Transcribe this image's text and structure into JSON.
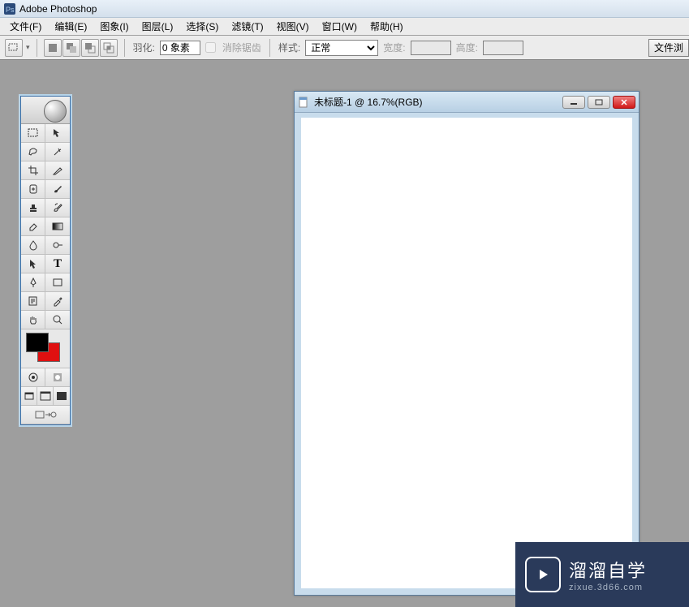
{
  "titlebar": {
    "app_name": "Adobe Photoshop"
  },
  "menubar": {
    "items": [
      {
        "label": "文件(F)"
      },
      {
        "label": "编辑(E)"
      },
      {
        "label": "图象(I)"
      },
      {
        "label": "图层(L)"
      },
      {
        "label": "选择(S)"
      },
      {
        "label": "滤镜(T)"
      },
      {
        "label": "视图(V)"
      },
      {
        "label": "窗口(W)"
      },
      {
        "label": "帮助(H)"
      }
    ]
  },
  "optionsbar": {
    "feather_label": "羽化:",
    "feather_value": "0 象素",
    "antialias_label": "消除锯齿",
    "style_label": "样式:",
    "style_value": "正常",
    "width_label": "宽度:",
    "width_value": "",
    "height_label": "高度:",
    "height_value": "",
    "file_browse_label": "文件浏"
  },
  "toolbox": {
    "tools": [
      [
        "rect-marquee",
        "move"
      ],
      [
        "lasso",
        "magic-wand"
      ],
      [
        "crop",
        "slice"
      ],
      [
        "healing",
        "brush"
      ],
      [
        "stamp",
        "history-brush"
      ],
      [
        "eraser",
        "gradient"
      ],
      [
        "blur",
        "dodge"
      ],
      [
        "path-select",
        "type"
      ],
      [
        "pen",
        "rectangle"
      ],
      [
        "notes",
        "eyedropper"
      ],
      [
        "hand",
        "zoom"
      ]
    ],
    "fg_color": "#000000",
    "bg_color": "#e01010",
    "mode_row": [
      "standard-mode",
      "quickmask-mode"
    ],
    "screen_row": [
      "screen-std",
      "screen-full-menu",
      "screen-full"
    ],
    "jump_row": [
      "jump-to"
    ]
  },
  "document": {
    "title": "未标题-1 @ 16.7%(RGB)"
  },
  "watermark": {
    "main": "溜溜自学",
    "sub": "zixue.3d66.com"
  }
}
